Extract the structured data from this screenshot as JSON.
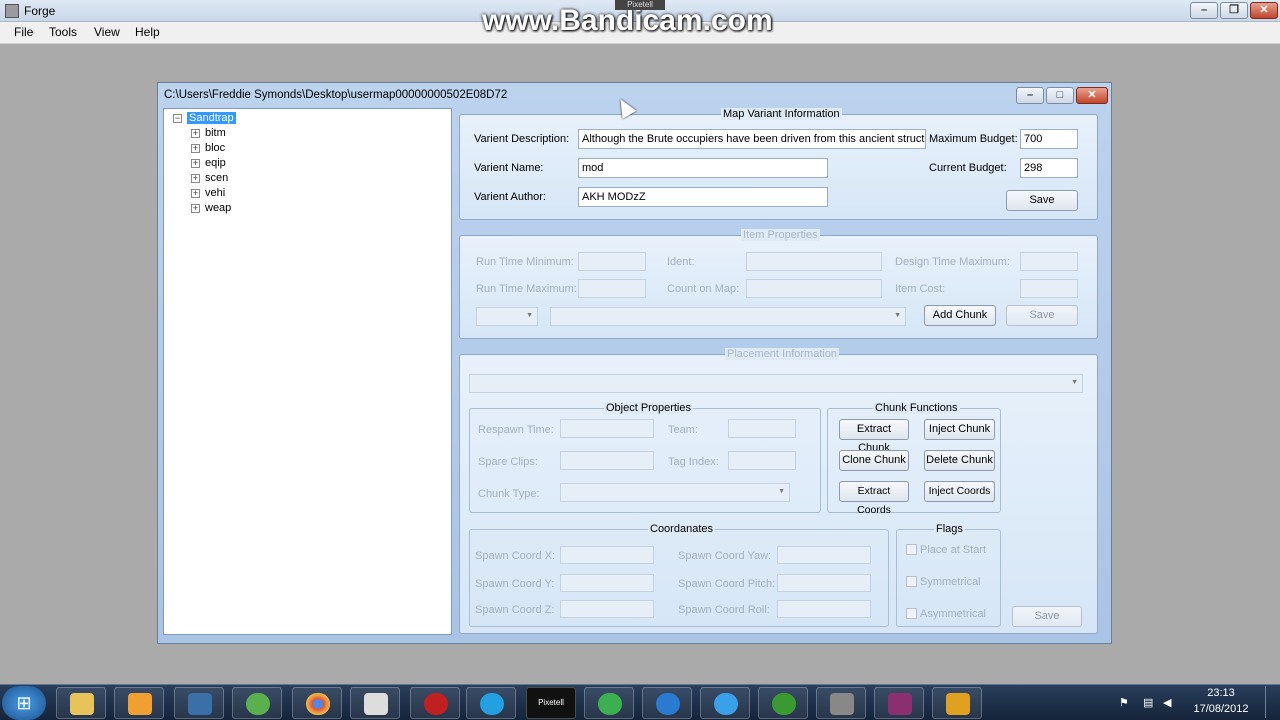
{
  "app": {
    "title": "Forge"
  },
  "overlay": {
    "watermark": "www.Bandicam.com",
    "pixetell": "Pixetell"
  },
  "menu": [
    "File",
    "Tools",
    "View",
    "Help"
  ],
  "child_window": {
    "title": "C:\\Users\\Freddie Symonds\\Desktop\\usermap00000000502E08D72"
  },
  "tree": {
    "root": "Sandtrap",
    "children": [
      "bitm",
      "bloc",
      "eqip",
      "scen",
      "vehi",
      "weap"
    ]
  },
  "map_variant": {
    "title": "Map Variant Information",
    "description_label": "Varient Description:",
    "description_value": "Although the Brute occupiers have been driven from this ancient structure, the",
    "name_label": "Varient Name:",
    "name_value": "mod",
    "author_label": "Varient Author:",
    "author_value": "AKH MODzZ",
    "max_budget_label": "Maximum Budget:",
    "max_budget_value": "700",
    "current_budget_label": "Current Budget:",
    "current_budget_value": "298",
    "save": "Save"
  },
  "item_properties": {
    "title": "Item Properties",
    "run_time_min": "Run Time Minimum:",
    "run_time_max": "Run Time Maximum:",
    "ident": "Ident:",
    "count_on_map": "Count on Map:",
    "design_time_max": "Design Time Maximum:",
    "item_cost": "Item Cost:",
    "add_chunk": "Add Chunk",
    "save": "Save"
  },
  "placement": {
    "title": "Placement Information",
    "object_properties": {
      "title": "Object Properties",
      "respawn_time": "Respawn Time:",
      "team": "Team:",
      "spare_clips": "Spare Clips:",
      "tag_index": "Tag Index:",
      "chunk_type": "Chunk Type:"
    },
    "chunk_functions": {
      "title": "Chunk Functions",
      "extract_chunk": "Extract Chunk",
      "inject_chunk": "Inject Chunk",
      "clone_chunk": "Clone Chunk",
      "delete_chunk": "Delete Chunk",
      "extract_coords": "Extract Coords",
      "inject_coords": "Inject Coords"
    },
    "coordinates": {
      "title": "Coordanates",
      "x": "Spawn Coord X:",
      "y": "Spawn Coord Y:",
      "z": "Spawn Coord Z:",
      "yaw": "Spawn Coord Yaw:",
      "pitch": "Spawn Coord Pitch:",
      "roll": "Spawn Coord Roll:"
    },
    "flags": {
      "title": "Flags",
      "place_at_start": "Place at Start",
      "symmetrical": "Symmetrical",
      "asymmetrical": "Asymmetrical"
    },
    "save": "Save"
  },
  "clock": {
    "time": "23:13",
    "date": "17/08/2012"
  },
  "taskbar": {
    "pixetell_label": "Pixetell"
  },
  "colors": {
    "accent": "#3399ff",
    "taskbar": "#1c2e47"
  }
}
